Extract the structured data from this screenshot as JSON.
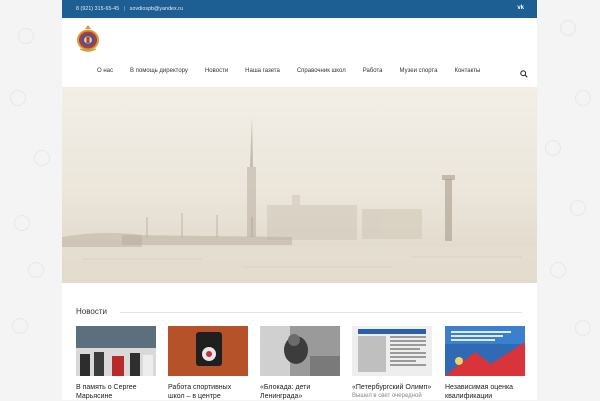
{
  "topbar": {
    "phone": "8 (921) 315-65-45",
    "separator": "|",
    "email": "sovdiospb@yandex.ru",
    "social_icon": "vk-icon",
    "social_label": "VK"
  },
  "logo": {
    "icon": "emblem-logo"
  },
  "nav": {
    "items": [
      {
        "label": "О нас"
      },
      {
        "label": "В помощь директору"
      },
      {
        "label": "Новости"
      },
      {
        "label": "Наша газета"
      },
      {
        "label": "Справочник школ"
      },
      {
        "label": "Работа"
      },
      {
        "label": "Музеи спорта"
      },
      {
        "label": "Контакты"
      }
    ],
    "search_icon": "search-icon"
  },
  "hero": {
    "image": "st-petersburg-watercolor-panorama"
  },
  "news": {
    "title": "Новости",
    "cards": [
      {
        "caption": "В память о Сергее Марьясине",
        "sub": ""
      },
      {
        "caption": "Работа спортивных школ – в центре",
        "sub": ""
      },
      {
        "caption": "«Блокада: дети Ленинграда»",
        "sub": ""
      },
      {
        "caption": "«Петербургский Олимп»",
        "sub": "Вышел в свет очередной"
      },
      {
        "caption": "Независимая оценка квалификации",
        "sub": ""
      }
    ]
  },
  "colors": {
    "topbar": "#1d5f92",
    "accent": "#1d5f92"
  }
}
